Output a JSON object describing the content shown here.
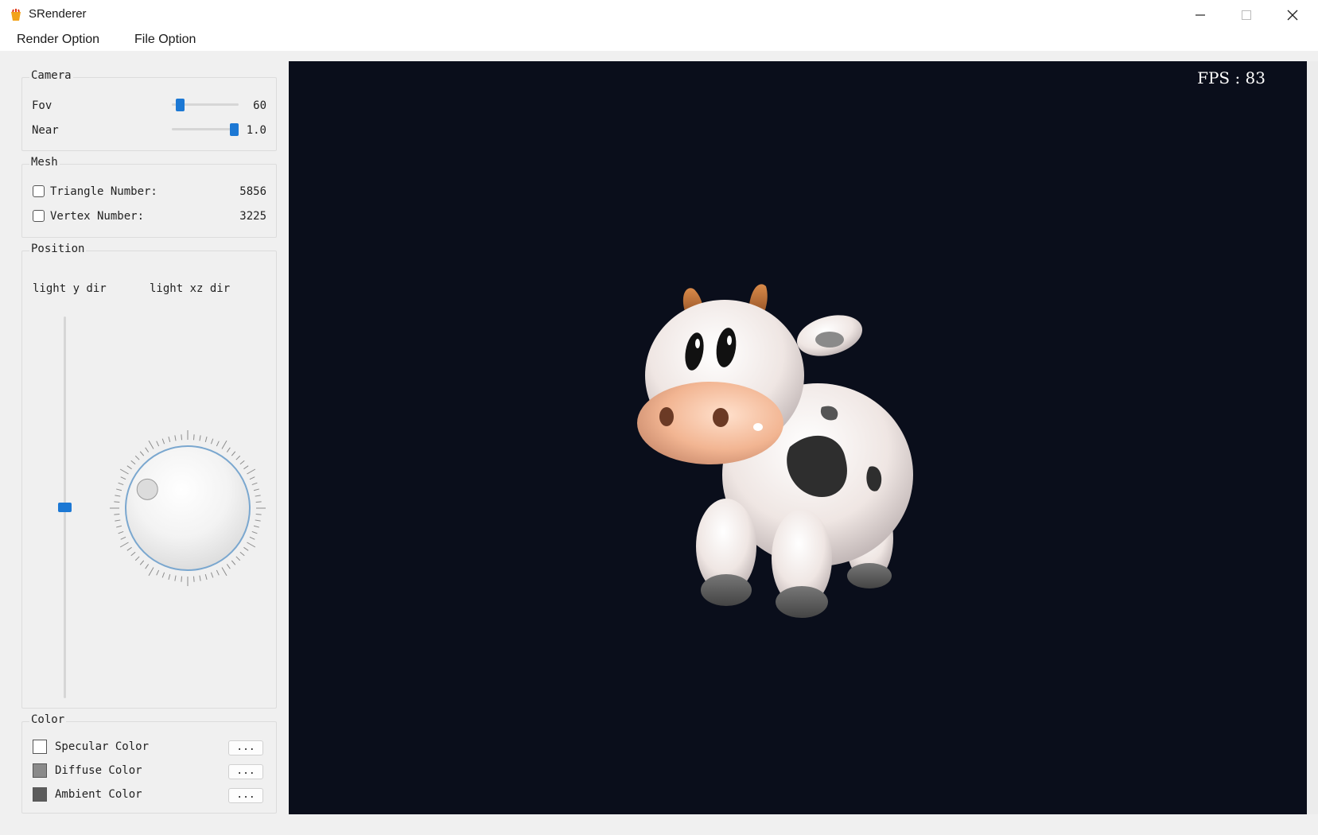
{
  "window": {
    "title": "SRenderer"
  },
  "menu": [
    "Render Option",
    "File Option"
  ],
  "camera": {
    "title": "Camera",
    "fov": {
      "label": "Fov",
      "value": "60",
      "slider_fraction": 0.07
    },
    "near": {
      "label": "Near",
      "value": "1.0",
      "slider_fraction": 1.0
    }
  },
  "mesh": {
    "title": "Mesh",
    "triangle": {
      "label": "Triangle Number:",
      "value": "5856",
      "checked": false
    },
    "vertex": {
      "label": "Vertex Number:",
      "value": "3225",
      "checked": false
    }
  },
  "position": {
    "title": "Position",
    "light_y_label": "light y dir",
    "light_xz_label": "light xz dir",
    "light_y_fraction": 0.5,
    "light_xz_angle_deg": 295
  },
  "color": {
    "title": "Color",
    "items": [
      {
        "label": "Specular Color",
        "swatch": "#ffffff",
        "button": "..."
      },
      {
        "label": "Diffuse Color",
        "swatch": "#8a8a8a",
        "button": "..."
      },
      {
        "label": "Ambient Color",
        "swatch": "#5c5c5c",
        "button": "..."
      }
    ]
  },
  "viewport": {
    "fps_label": "FPS : 83",
    "background": "#0a0e1b"
  },
  "colors": {
    "accent": "#1c78d4"
  }
}
